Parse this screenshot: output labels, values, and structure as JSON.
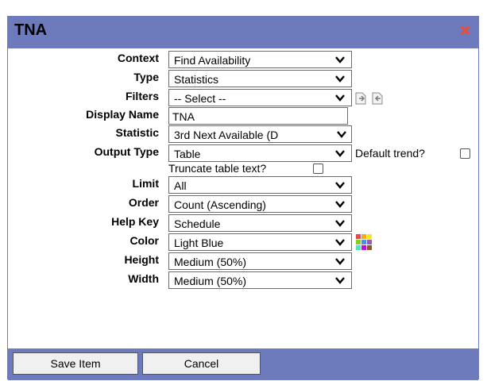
{
  "dialog": {
    "title": "TNA",
    "close_icon": "close-icon"
  },
  "form": {
    "context": {
      "label": "Context",
      "value": "Find Availability"
    },
    "type": {
      "label": "Type",
      "value": "Statistics"
    },
    "filters": {
      "label": "Filters",
      "value": "-- Select --",
      "icons": [
        "add-filter-icon",
        "remove-filter-icon"
      ]
    },
    "display_name": {
      "label": "Display Name",
      "value": "TNA"
    },
    "statistic": {
      "label": "Statistic",
      "value": "3rd Next Available (D"
    },
    "output_type": {
      "label": "Output Type",
      "value": "Table",
      "default_trend_label": "Default trend?"
    },
    "truncate": {
      "label": "Truncate table text?"
    },
    "limit": {
      "label": "Limit",
      "value": "All"
    },
    "order": {
      "label": "Order",
      "value": "Count (Ascending)"
    },
    "help_key": {
      "label": "Help Key",
      "value": "Schedule"
    },
    "color": {
      "label": "Color",
      "value": "Light Blue",
      "icon": "color-palette-icon"
    },
    "height": {
      "label": "Height",
      "value": "Medium (50%)"
    },
    "width": {
      "label": "Width",
      "value": "Medium (50%)"
    }
  },
  "footer": {
    "save_label": "Save Item",
    "cancel_label": "Cancel"
  },
  "colors": {
    "titlebar": "#6d7bbd",
    "close": "#e74c3c"
  }
}
